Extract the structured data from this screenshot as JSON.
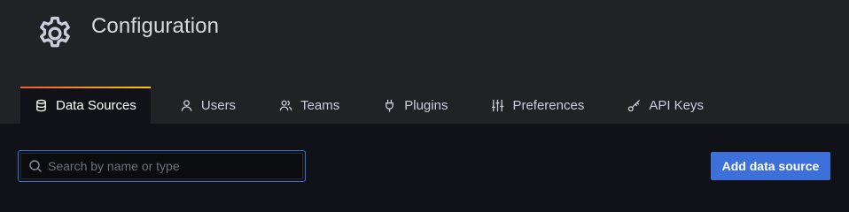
{
  "page": {
    "title": "Configuration",
    "icon": "gear-icon"
  },
  "tabs": [
    {
      "label": "Data Sources",
      "icon": "database-icon",
      "active": true
    },
    {
      "label": "Users",
      "icon": "user-icon",
      "active": false
    },
    {
      "label": "Teams",
      "icon": "users-icon",
      "active": false
    },
    {
      "label": "Plugins",
      "icon": "plug-icon",
      "active": false
    },
    {
      "label": "Preferences",
      "icon": "sliders-icon",
      "active": false
    },
    {
      "label": "API Keys",
      "icon": "key-icon",
      "active": false
    }
  ],
  "search": {
    "placeholder": "Search by name or type",
    "value": ""
  },
  "actions": {
    "add_label": "Add data source"
  },
  "colors": {
    "header_bg": "#202226",
    "page_bg": "#111217",
    "accent": "#3d71d9",
    "tab_gradient_start": "#f05a28",
    "tab_gradient_end": "#fbca0a"
  }
}
